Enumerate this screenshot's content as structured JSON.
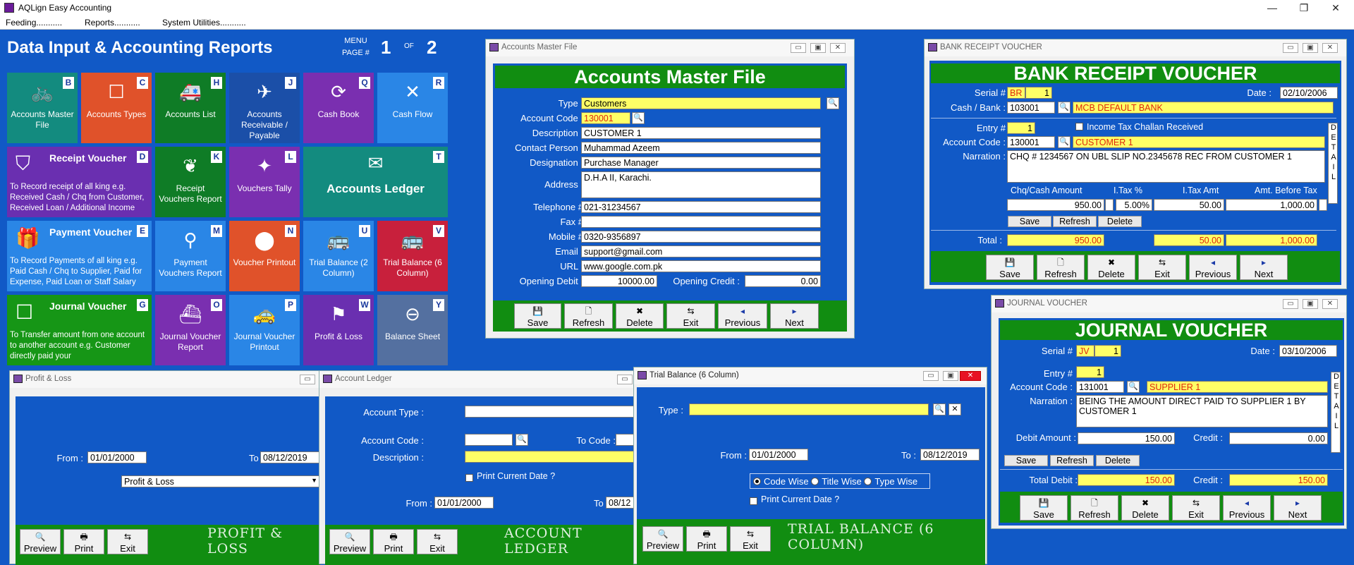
{
  "app": {
    "title": "AQLign Easy Accounting"
  },
  "menu": {
    "feeding": "Feeding...........",
    "reports": "Reports...........",
    "utilities": "System Utilities..........."
  },
  "header": {
    "title": "Data Input & Accounting Reports",
    "menu_label": "MENU",
    "page_label": "PAGE #",
    "page_current": "1",
    "of_label": "OF",
    "page_total": "2"
  },
  "tiles": [
    {
      "label": "Accounts Master File",
      "key": "B",
      "color": "#138b7f",
      "icon": "bicycle-icon",
      "glyph": "🚲"
    },
    {
      "label": "Accounts Types",
      "key": "C",
      "color": "#e0522a",
      "icon": "square-icon",
      "glyph": "☐"
    },
    {
      "label": "Accounts List",
      "key": "H",
      "color": "#0f7c26",
      "icon": "ambulance-icon",
      "glyph": "🚑"
    },
    {
      "label": "Accounts Receivable / Payable",
      "key": "J",
      "color": "#1b4fa8",
      "icon": "airplane-icon",
      "glyph": "✈"
    },
    {
      "label": "Cash Book",
      "key": "Q",
      "color": "#7a2fb0",
      "icon": "refresh-icon",
      "glyph": "⟳"
    },
    {
      "label": "Cash Flow",
      "key": "R",
      "color": "#2a86e6",
      "icon": "close-x-icon",
      "glyph": "✕"
    },
    {
      "title": "Receipt Voucher",
      "key": "D",
      "color": "#6a2fb0",
      "icon": "shield-icon",
      "glyph": "⛉",
      "desc": "To Record receipt of all king e.g. Received Cash / Chq from Customer, Received Loan / Additional Income"
    },
    {
      "label": "Receipt Vouchers Report",
      "key": "K",
      "color": "#0f7c26",
      "icon": "leaf-icon",
      "glyph": "❦"
    },
    {
      "label": "Vouchers Tally",
      "key": "L",
      "color": "#7a2fb0",
      "icon": "star-icon",
      "glyph": "✦"
    },
    {
      "label": "Accounts Ledger",
      "key": "T",
      "color": "#138b7f",
      "icon": "ledger-icon",
      "glyph": "✉"
    },
    {
      "title": "Payment Voucher",
      "key": "E",
      "color": "#2a86e6",
      "icon": "gift-icon",
      "glyph": "🎁",
      "desc": "To Record Payments of all king e.g. Paid Cash / Chq to Supplier, Paid for Expense, Paid Loan or Staff Salary"
    },
    {
      "label": "Payment Vouchers Report",
      "key": "M",
      "color": "#2a86e6",
      "icon": "bulb-icon",
      "glyph": "⚲"
    },
    {
      "label": "Voucher Printout",
      "key": "N",
      "color": "#e0522a",
      "icon": "circle-icon",
      "glyph": "⬤"
    },
    {
      "label": "Trial Balance (2 Column)",
      "key": "U",
      "color": "#2a86e6",
      "icon": "bus-icon",
      "glyph": "🚌"
    },
    {
      "label": "Trial Balance (6 Column)",
      "key": "V",
      "color": "#c8203c",
      "icon": "bus-icon",
      "glyph": "🚌"
    },
    {
      "title": "Journal Voucher",
      "key": "G",
      "color": "#169616",
      "icon": "page-icon",
      "glyph": "☐",
      "desc": "To Transfer amount from one account to another account e.g. Customer directly paid your"
    },
    {
      "label": "Journal Voucher Report",
      "key": "O",
      "color": "#7a2fb0",
      "icon": "ship-icon",
      "glyph": "⛴"
    },
    {
      "label": "Journal Voucher Printout",
      "key": "P",
      "color": "#2a86e6",
      "icon": "taxi-icon",
      "glyph": "🚕"
    },
    {
      "label": "Profit & Loss",
      "key": "W",
      "color": "#6a2fb0",
      "icon": "flag-icon",
      "glyph": "⚑"
    },
    {
      "label": "Balance Sheet",
      "key": "Y",
      "color": "#5470a0",
      "icon": "minus-circle-icon",
      "glyph": "⊖"
    }
  ],
  "accounts_master": {
    "window_title": "Accounts Master File",
    "heading": "Accounts Master File",
    "type_label": "Type :",
    "type": "Customers",
    "code_label": "Account Code :",
    "code": "130001",
    "desc_label": "Description :",
    "desc": "CUSTOMER 1",
    "contact_label": "Contact Person :",
    "contact": "Muhammad Azeem",
    "designation_label": "Designation :",
    "designation": "Purchase Manager",
    "address_label": "Address :",
    "address": "D.H.A II, Karachi.",
    "tel_label": "Telephone #",
    "tel": "021-31234567",
    "fax_label": "Fax #",
    "fax": "",
    "mobile_label": "Mobile #",
    "mobile": "0320-9356897",
    "email_label": "Email :",
    "email": "support@gmail.com",
    "url_label": "URL :",
    "url": "www.google.com.pk",
    "opening_debit_label": "Opening Debit :",
    "opening_debit": "10000.00",
    "opening_credit_label": "Opening Credit :",
    "opening_credit": "0.00"
  },
  "buttons": {
    "save": "Save",
    "refresh": "Refresh",
    "delete": "Delete",
    "exit": "Exit",
    "previous": "Previous",
    "next": "Next",
    "preview": "Preview",
    "print": "Print"
  },
  "bank_receipt": {
    "window_title": "BANK RECEIPT VOUCHER",
    "heading": "BANK RECEIPT VOUCHER",
    "serial_label": "Serial #",
    "serial_prefix": "BR",
    "serial": "1",
    "date_label": "Date :",
    "date": "02/10/2006",
    "cash_label": "Cash / Bank :",
    "cash_code": "103001",
    "cash_name": "MCB DEFAULT BANK",
    "entry_label": "Entry #",
    "entry": "1",
    "tax_challan": "Income Tax Challan Received",
    "code_label": "Account Code :",
    "code": "130001",
    "account_name": "CUSTOMER 1",
    "narration_label": "Narration :",
    "narration": "CHQ # 1234567 ON UBL SLIP NO.2345678 REC FROM CUSTOMER 1",
    "col_amount": "Chq/Cash Amount",
    "col_itax_pct": "I.Tax %",
    "col_itax_amt": "I.Tax Amt",
    "col_before_tax": "Amt. Before Tax",
    "amount": "950.00",
    "itax_pct": "5.00%",
    "itax_amt": "50.00",
    "before_tax": "1,000.00",
    "total_label": "Total :",
    "total_amount": "950.00",
    "total_itax": "50.00",
    "total_before": "1,000.00",
    "detail": "DETAIL"
  },
  "journal": {
    "window_title": "JOURNAL VOUCHER",
    "heading": "JOURNAL VOUCHER",
    "serial_label": "Serial #",
    "serial_prefix": "JV",
    "serial": "1",
    "date_label": "Date :",
    "date": "03/10/2006",
    "entry_label": "Entry #",
    "entry": "1",
    "code_label": "Account Code :",
    "code": "131001",
    "account_name": "SUPPLIER 1",
    "narration_label": "Narration :",
    "narration": "BEING THE AMOUNT DIRECT PAID TO SUPPLIER 1 BY CUSTOMER 1",
    "debit_label": "Debit Amount :",
    "debit": "150.00",
    "credit_label": "Credit :",
    "credit": "0.00",
    "total_debit_label": "Total Debit :",
    "total_debit": "150.00",
    "total_credit_label": "Credit :",
    "total_credit": "150.00",
    "detail": "DETAIL"
  },
  "profit_loss": {
    "window_title": "Profit & Loss",
    "from_label": "From :",
    "from": "01/01/2000",
    "to_label": "To :",
    "to": "08/12/2019",
    "report": "Profit & Loss",
    "heading": "PROFIT & LOSS"
  },
  "ledger": {
    "window_title": "Account Ledger",
    "type_label": "Account Type :",
    "code_label": "Account Code :",
    "to_code_label": "To Code :",
    "desc_label": "Description :",
    "print_date": "Print Current Date ?",
    "from_label": "From :",
    "from": "01/01/2000",
    "to_label": "To :",
    "to": "08/12",
    "heading": "ACCOUNT LEDGER"
  },
  "trial": {
    "window_title": "Trial Balance (6 Column)",
    "type_label": "Type :",
    "from_label": "From :",
    "from": "01/01/2000",
    "to_label": "To :",
    "to": "08/12/2019",
    "code_wise": "Code Wise",
    "title_wise": "Title Wise",
    "type_wise": "Type Wise",
    "print_date": "Print Current Date ?",
    "heading": "TRIAL BALANCE (6 COLUMN)"
  }
}
